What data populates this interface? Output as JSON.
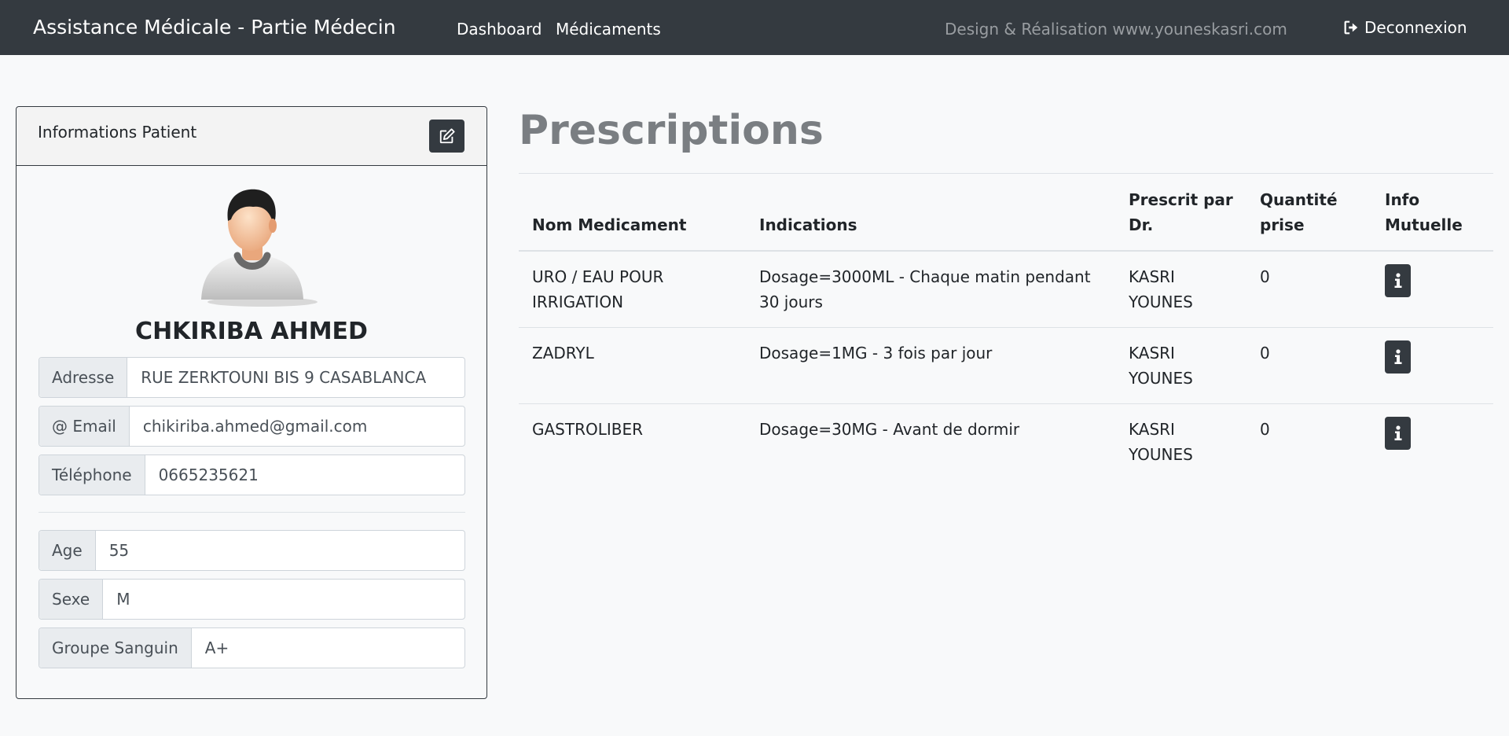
{
  "navbar": {
    "brand": "Assistance Médicale - Partie Médecin",
    "links": [
      "Dashboard",
      "Médicaments"
    ],
    "credit": "Design & Réalisation www.youneskasri.com",
    "logout": "Deconnexion"
  },
  "patient_card": {
    "header": "Informations Patient",
    "name": "CHKIRIBA AHMED",
    "fields": [
      {
        "label": "Adresse",
        "value": "RUE ZERKTOUNI BIS 9 CASABLANCA"
      },
      {
        "label": "@ Email",
        "value": "chikiriba.ahmed@gmail.com"
      },
      {
        "label": "Téléphone",
        "value": "0665235621"
      },
      {
        "label": "Age",
        "value": "55"
      },
      {
        "label": "Sexe",
        "value": "M"
      },
      {
        "label": "Groupe Sanguin",
        "value": "A+"
      }
    ]
  },
  "prescriptions": {
    "title": "Prescriptions",
    "headers": [
      "Nom Medicament",
      "Indications",
      "Prescrit par Dr.",
      "Quantité prise",
      "Info Mutuelle"
    ],
    "rows": [
      {
        "medicament": "URO / EAU POUR IRRIGATION",
        "indications": "Dosage=3000ML - Chaque matin pendant 30 jours",
        "doctor": "KASRI YOUNES",
        "quantite": "0"
      },
      {
        "medicament": "ZADRYL",
        "indications": "Dosage=1MG - 3 fois par jour",
        "doctor": "KASRI YOUNES",
        "quantite": "0"
      },
      {
        "medicament": "GASTROLIBER",
        "indications": "Dosage=30MG - Avant de dormir",
        "doctor": "KASRI YOUNES",
        "quantite": "0"
      }
    ]
  },
  "colors": {
    "navbar": "#343a40",
    "background": "#f8f9fa",
    "button": "#343a40"
  },
  "icons": {
    "logout": "sign-out-icon",
    "edit": "edit-icon",
    "info": "info-icon",
    "avatar": "user-avatar"
  }
}
